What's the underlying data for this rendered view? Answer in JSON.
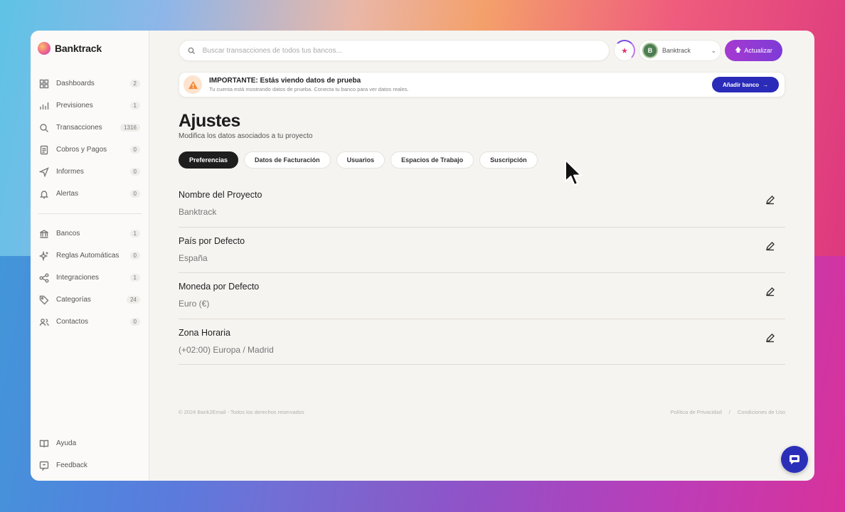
{
  "brand": {
    "name": "Banktrack"
  },
  "sidebar": {
    "items": [
      {
        "label": "Dashboards",
        "count": "2",
        "icon": "grid-icon"
      },
      {
        "label": "Previsiones",
        "count": "1",
        "icon": "bar-chart-icon"
      },
      {
        "label": "Transacciones",
        "count": "1316",
        "icon": "search-icon"
      },
      {
        "label": "Cobros y Pagos",
        "count": "0",
        "icon": "document-icon"
      },
      {
        "label": "Informes",
        "count": "0",
        "icon": "send-icon"
      },
      {
        "label": "Alertas",
        "count": "0",
        "icon": "bell-icon"
      }
    ],
    "items2": [
      {
        "label": "Bancos",
        "count": "1",
        "icon": "bank-icon"
      },
      {
        "label": "Reglas Automáticas",
        "count": "0",
        "icon": "sparkle-icon"
      },
      {
        "label": "Integraciones",
        "count": "1",
        "icon": "share-icon"
      },
      {
        "label": "Categorías",
        "count": "24",
        "icon": "tag-icon"
      },
      {
        "label": "Contactos",
        "count": "0",
        "icon": "users-icon"
      }
    ],
    "bottom": [
      {
        "label": "Ayuda",
        "icon": "book-icon"
      },
      {
        "label": "Feedback",
        "icon": "feedback-icon"
      }
    ]
  },
  "topbar": {
    "search_placeholder": "Buscar transacciones de todos tus bancos...",
    "account_initial": "B",
    "account_name": "Banktrack",
    "upgrade_label": "Actualizar"
  },
  "banner": {
    "title": "IMPORTANTE: Estás viendo datos de prueba",
    "subtitle": "Tu cuenta está mostrando datos de prueba. Conecta tu banco para ver datos reales.",
    "button_label": "Añadir banco"
  },
  "page": {
    "title": "Ajustes",
    "subtitle": "Modifica los datos asociados a tu proyecto"
  },
  "tabs": [
    "Preferencias",
    "Datos de Facturación",
    "Usuarios",
    "Espacios de Trabajo",
    "Suscripción"
  ],
  "settings": [
    {
      "label": "Nombre del Proyecto",
      "value": "Banktrack"
    },
    {
      "label": "País por Defecto",
      "value": "España"
    },
    {
      "label": "Moneda por Defecto",
      "value": "Euro (€)"
    },
    {
      "label": "Zona Horaria",
      "value": "(+02:00) Europa / Madrid"
    }
  ],
  "footer": {
    "copyright": "© 2024 Bank2Email - Todos los derechos reservados",
    "privacy": "Política de Privacidad",
    "separator": "/",
    "terms": "Condiciones de Uso"
  },
  "colors": {
    "accent": "#2a2bb8",
    "upgrade": "#8e3ad4",
    "active_tab": "#1e1e1e"
  }
}
